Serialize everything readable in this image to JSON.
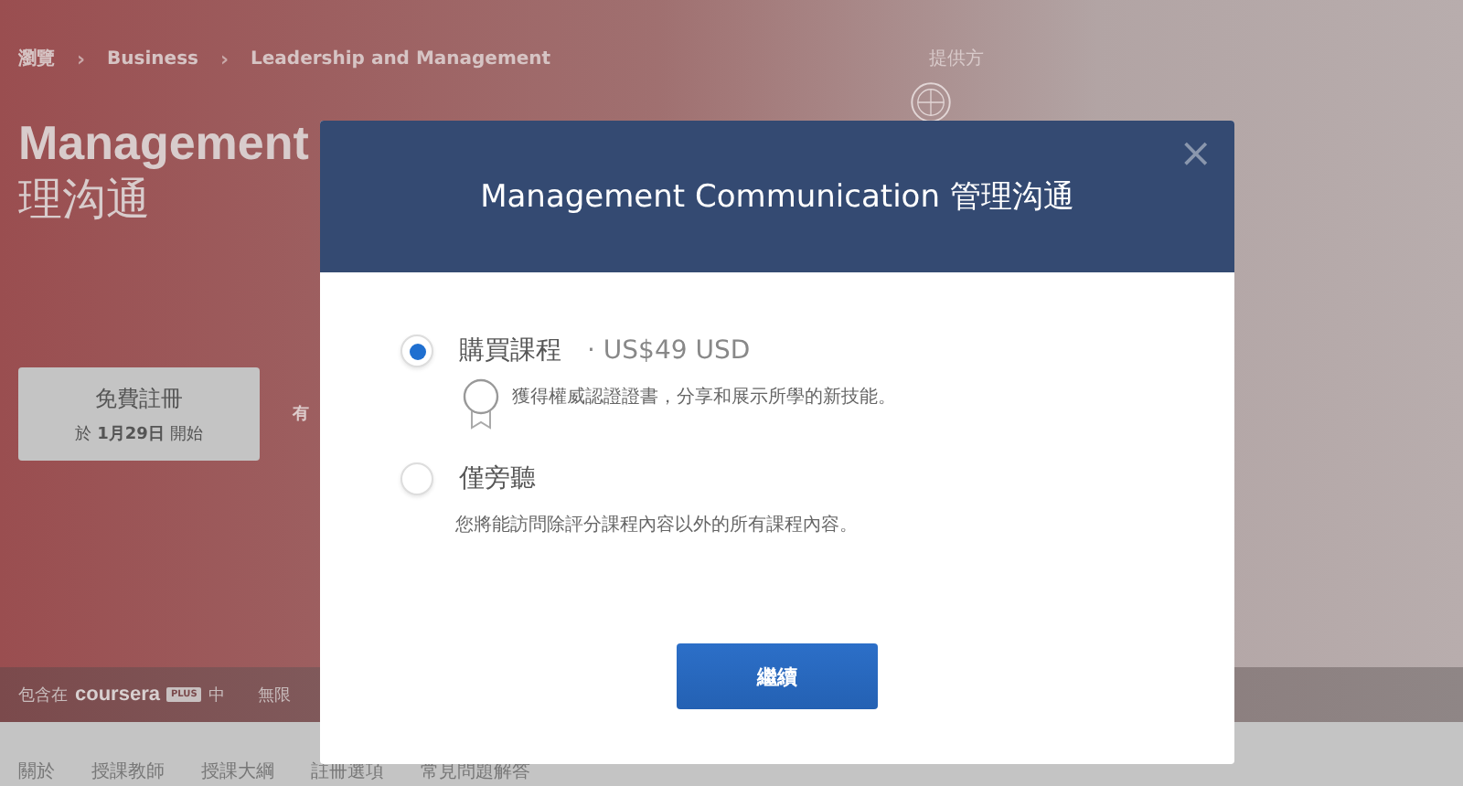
{
  "breadcrumb": [
    {
      "label": "瀏覽"
    },
    {
      "separator": "›",
      "label": "Business"
    },
    {
      "separator": "›",
      "label": "Leadership and Management"
    }
  ],
  "course_title": {
    "line_1": "Management",
    "line_2": "理沟通"
  },
  "provider": {
    "label": "提供方"
  },
  "enroll_button": {
    "label": "免費註冊",
    "start": "於 **1月29日** 開始"
  },
  "hidden_note": "有",
  "plus_strip": {
    "prefix": "包含在",
    "brand": "coursera",
    "badge": "PLUS",
    "suffix": "中",
    "next": "無限"
  },
  "nav_tabs": [
    {
      "label": "關於"
    },
    {
      "label": "授課教師"
    },
    {
      "label": "授課大綱"
    },
    {
      "label": "註冊選項"
    },
    {
      "label": "常見問題解答"
    }
  ],
  "modal": {
    "title": "Management Communication 管理沟通",
    "close": "×",
    "options": [
      {
        "kind": "certificate",
        "label": "購買課程",
        "price": "· US$49 USD",
        "description": "獲得權威認證證書，分享和展示所學的新技能。",
        "selected": true
      },
      {
        "kind": "plain",
        "label": "僅旁聽",
        "description": "您將能訪問除評分課程內容以外的所有課程內容。",
        "selected": false
      }
    ],
    "continue_button": "繼續"
  }
}
